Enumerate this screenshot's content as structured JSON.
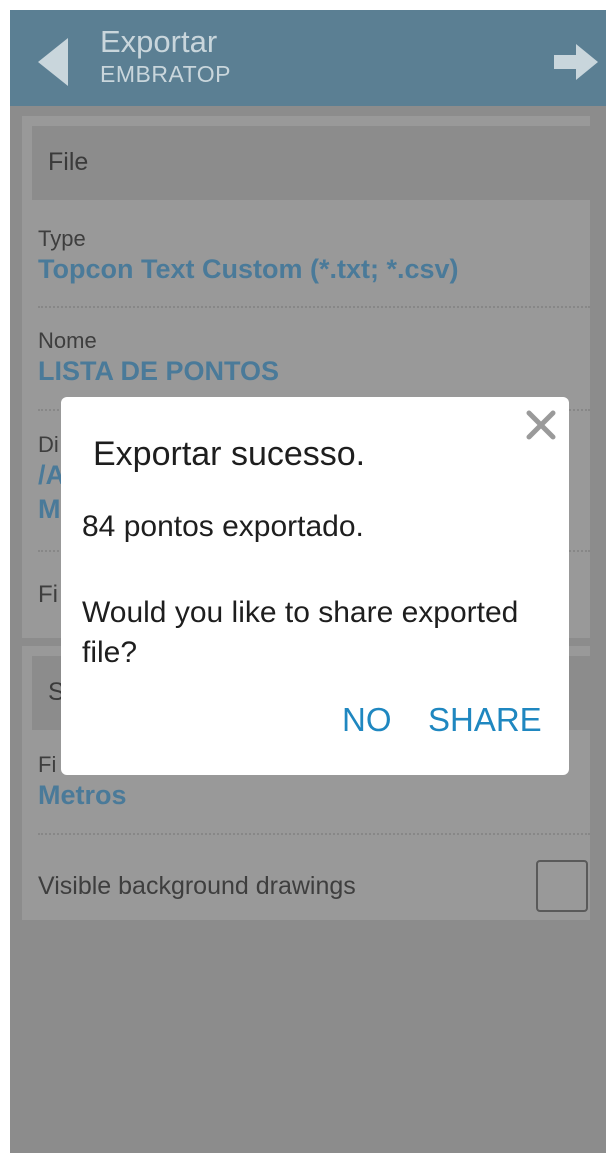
{
  "appbar": {
    "title": "Exportar",
    "subtitle": "EMBRATOP",
    "back_icon": "back-triangle-icon",
    "forward_icon": "arrow-right-icon"
  },
  "file_section": {
    "header": "File",
    "fields": [
      {
        "label": "Type",
        "value": "Topcon Text Custom (*.txt; *.csv)"
      },
      {
        "label": "Nome",
        "value": "LISTA DE PONTOS"
      },
      {
        "label": "Di",
        "value": "/A",
        "value2": "M"
      },
      {
        "label": "Fi"
      }
    ]
  },
  "second_section": {
    "header": "S",
    "fields": [
      {
        "label": "Fi",
        "value": "Metros"
      }
    ],
    "visible_background": {
      "label": "Visible background drawings",
      "checked": false
    }
  },
  "dialog": {
    "title": "Exportar sucesso.",
    "message1": "84 pontos exportado.",
    "message2": "Would you like to share exported file?",
    "no_label": "NO",
    "share_label": "SHARE",
    "close_icon": "close-icon"
  },
  "colors": {
    "appbar": "#5b7f93",
    "accent_value": "#4a7a99",
    "button": "#1f87c0",
    "overlay_bg": "#8c8c8c"
  }
}
